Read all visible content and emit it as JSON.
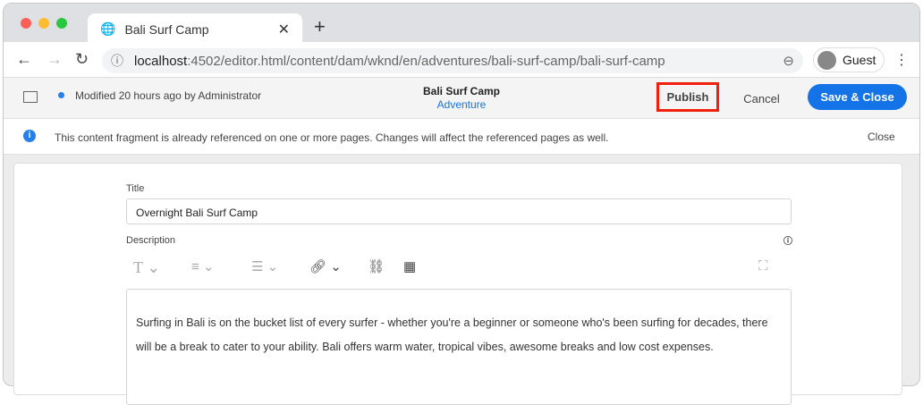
{
  "browser": {
    "tab_title": "Bali Surf Camp",
    "url_host": "localhost",
    "url_rest": ":4502/editor.html/content/dam/wknd/en/adventures/bali-surf-camp/bali-surf-camp",
    "profile": "Guest"
  },
  "editor": {
    "status": "Modified 20 hours ago by Administrator",
    "title": "Bali Surf Camp",
    "model": "Adventure",
    "publish": "Publish",
    "cancel": "Cancel",
    "save": "Save & Close",
    "accent": "#1473e6"
  },
  "notice": {
    "text": "This content fragment is already referenced on one or more pages. Changes will affect the referenced pages as well.",
    "close": "Close"
  },
  "form": {
    "title_label": "Title",
    "title_value": "Overnight Bali Surf Camp",
    "desc_label": "Description",
    "desc_text": "Surfing in Bali is on the bucket list of every surfer - whether you're a beginner or someone who's been surfing for decades, there will be a break to cater to your ability. Bali offers warm water, tropical vibes, awesome breaks and low cost expenses."
  }
}
